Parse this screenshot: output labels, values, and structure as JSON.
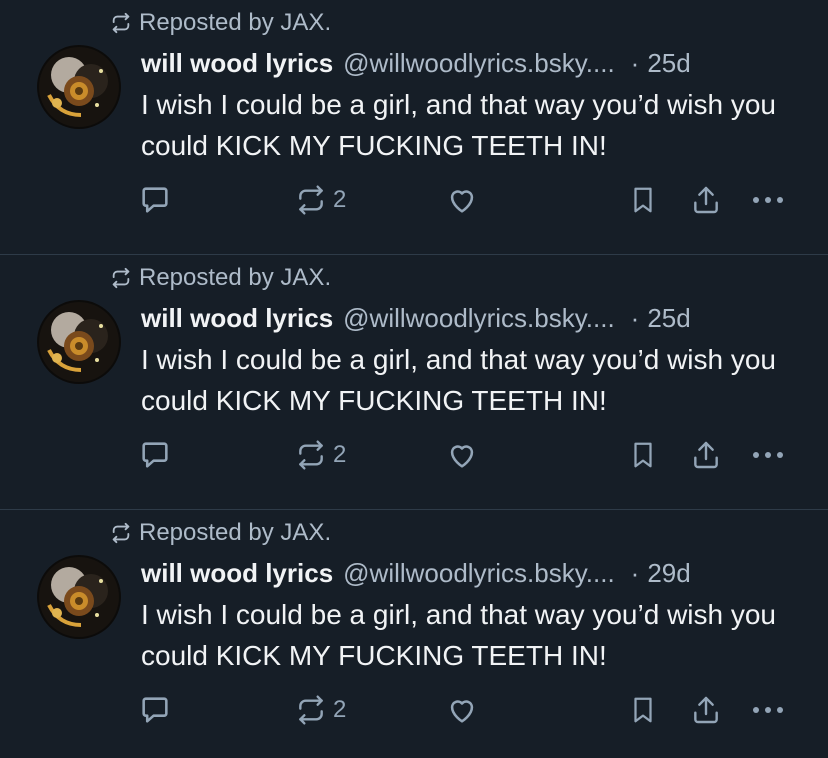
{
  "colors": {
    "background": "#161e27",
    "divider": "#2e3b48",
    "text_primary": "#f1f3f5",
    "text_secondary": "#aebbc9",
    "icon": "#93a5b7"
  },
  "posts": [
    {
      "repost_label": "Reposted by JAX.",
      "author": "will wood lyrics",
      "handle": "@willwoodlyrics.bsky....",
      "separator": "·",
      "age": "25d",
      "text": "I wish I could be a girl, and that way you’d wish you could KICK MY FUCKING TEETH IN!",
      "repost_count": "2",
      "icons": [
        "repost-icon",
        "reply-icon",
        "repost-icon",
        "heart-icon",
        "bookmark-icon",
        "share-icon",
        "more-icon"
      ]
    },
    {
      "repost_label": "Reposted by JAX.",
      "author": "will wood lyrics",
      "handle": "@willwoodlyrics.bsky....",
      "separator": "·",
      "age": "25d",
      "text": "I wish I could be a girl, and that way you’d wish you could KICK MY FUCKING TEETH IN!",
      "repost_count": "2",
      "icons": [
        "repost-icon",
        "reply-icon",
        "repost-icon",
        "heart-icon",
        "bookmark-icon",
        "share-icon",
        "more-icon"
      ]
    },
    {
      "repost_label": "Reposted by JAX.",
      "author": "will wood lyrics",
      "handle": "@willwoodlyrics.bsky....",
      "separator": "·",
      "age": "29d",
      "text": "I wish I could be a girl, and that way you’d wish you could KICK MY FUCKING TEETH IN!",
      "repost_count": "2",
      "icons": [
        "repost-icon",
        "reply-icon",
        "repost-icon",
        "heart-icon",
        "bookmark-icon",
        "share-icon",
        "more-icon"
      ]
    }
  ]
}
